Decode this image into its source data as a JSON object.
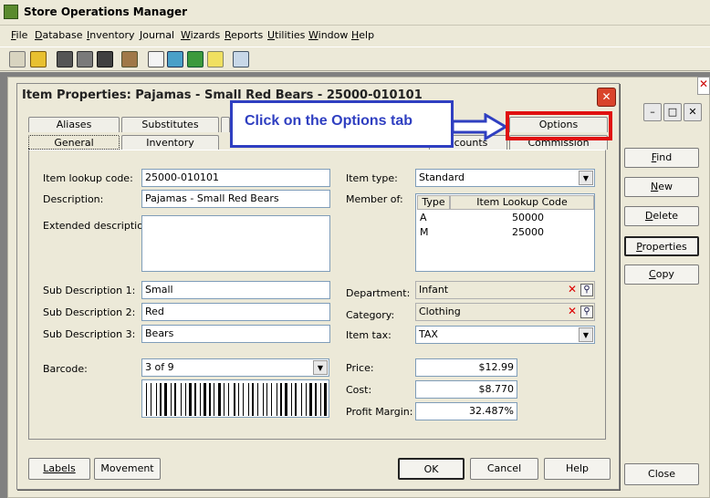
{
  "app": {
    "title": "Store Operations Manager"
  },
  "menu": [
    {
      "key": "F",
      "rest": "ile"
    },
    {
      "key": "D",
      "rest": "atabase"
    },
    {
      "key": "I",
      "rest": "nventory"
    },
    {
      "key": "J",
      "rest": "ournal"
    },
    {
      "key": "W",
      "rest": "izards"
    },
    {
      "key": "R",
      "rest": "eports"
    },
    {
      "key": "U",
      "rest": "tilities"
    },
    {
      "key": "W",
      "rest": "indow"
    },
    {
      "key": "H",
      "rest": "elp"
    }
  ],
  "toolbar_icons": [
    "edit-icon",
    "lock-icon",
    "users-icon",
    "calculator-icon",
    "truck-icon",
    "box-icon",
    "document-icon",
    "register-icon",
    "folder-icon",
    "tag-icon",
    "report-icon"
  ],
  "bg_window": {
    "buttons": [
      {
        "key": "F",
        "rest": "ind"
      },
      {
        "key": "N",
        "rest": "ew"
      },
      {
        "key": "D",
        "rest": "elete"
      },
      {
        "key": "P",
        "rest": "roperties"
      },
      {
        "key": "C",
        "rest": "opy"
      },
      {
        "label": "Close"
      }
    ]
  },
  "dialog": {
    "title": "Item Properties: Pajamas - Small Red Bears - 25000-010101",
    "tabs_back": [
      "Aliases",
      "Substitutes",
      "",
      "Options"
    ],
    "tabs_front": [
      "General",
      "Inventory",
      "ccounts",
      "Commission"
    ],
    "callout": "Click on the Options tab",
    "labels": {
      "lookup": "Item lookup code:",
      "description": "Description:",
      "extended": "Extended description:",
      "sub1": "Sub Description 1:",
      "sub2": "Sub Description 2:",
      "sub3": "Sub Description 3:",
      "barcode": "Barcode:",
      "item_type": "Item type:",
      "member_of": "Member of:",
      "department": "Department:",
      "category": "Category:",
      "item_tax": "Item tax:",
      "price": "Price:",
      "cost": "Cost:",
      "margin": "Profit Margin:"
    },
    "values": {
      "lookup": "25000-010101",
      "description": "Pajamas - Small Red Bears",
      "extended": "",
      "sub1": "Small",
      "sub2": "Red",
      "sub3": "Bears",
      "barcode": "3 of 9",
      "item_type": "Standard",
      "department": "Infant",
      "category": "Clothing",
      "item_tax": "TAX",
      "price": "$12.99",
      "cost": "$8.770",
      "margin": "32.487%"
    },
    "member_list": {
      "headers": [
        "Type",
        "Item Lookup Code"
      ],
      "rows": [
        [
          "A",
          "50000"
        ],
        [
          "M",
          "25000"
        ]
      ]
    },
    "buttons": {
      "labels": "Labels",
      "movement": "Movement",
      "ok": "OK",
      "cancel": "Cancel",
      "help": "Help"
    }
  }
}
